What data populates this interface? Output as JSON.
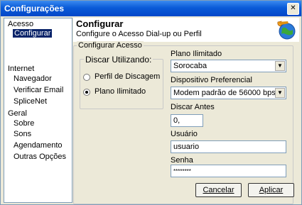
{
  "window": {
    "title": "Configurações",
    "close_glyph": "✕"
  },
  "sidebar": {
    "sections": [
      {
        "label": "Acesso",
        "items": [
          "Configurar"
        ]
      },
      {
        "label": "Internet",
        "items": [
          "Navegador",
          "Verificar Email",
          "SpliceNet"
        ]
      },
      {
        "label": "Geral",
        "items": [
          "Sobre",
          "Sons",
          "Agendamento",
          "Outras Opções"
        ]
      }
    ]
  },
  "header": {
    "title": "Configurar",
    "subtitle": "Configure o Acesso Dial-up ou Perfil",
    "icon": "globe-phone-icon"
  },
  "group": {
    "legend": "Configurar Acesso",
    "discar": {
      "legend": "Discar Utilizando:",
      "options": [
        "Perfil de Discagem",
        "Plano Ilimitado"
      ],
      "selected": "Plano Ilimitado"
    },
    "plano_label": "Plano Ilimitado",
    "plano_value": "Sorocaba",
    "dispositivo_label": "Dispositivo Preferencial",
    "dispositivo_value": "Modem padrão de 56000 bps",
    "discar_antes_label": "Discar Antes",
    "discar_antes_value": "0,",
    "usuario_label": "Usuário",
    "usuario_value": "usuario",
    "senha_label": "Senha",
    "senha_value": "********"
  },
  "buttons": {
    "cancel": "Cancelar",
    "apply": "Aplicar"
  }
}
